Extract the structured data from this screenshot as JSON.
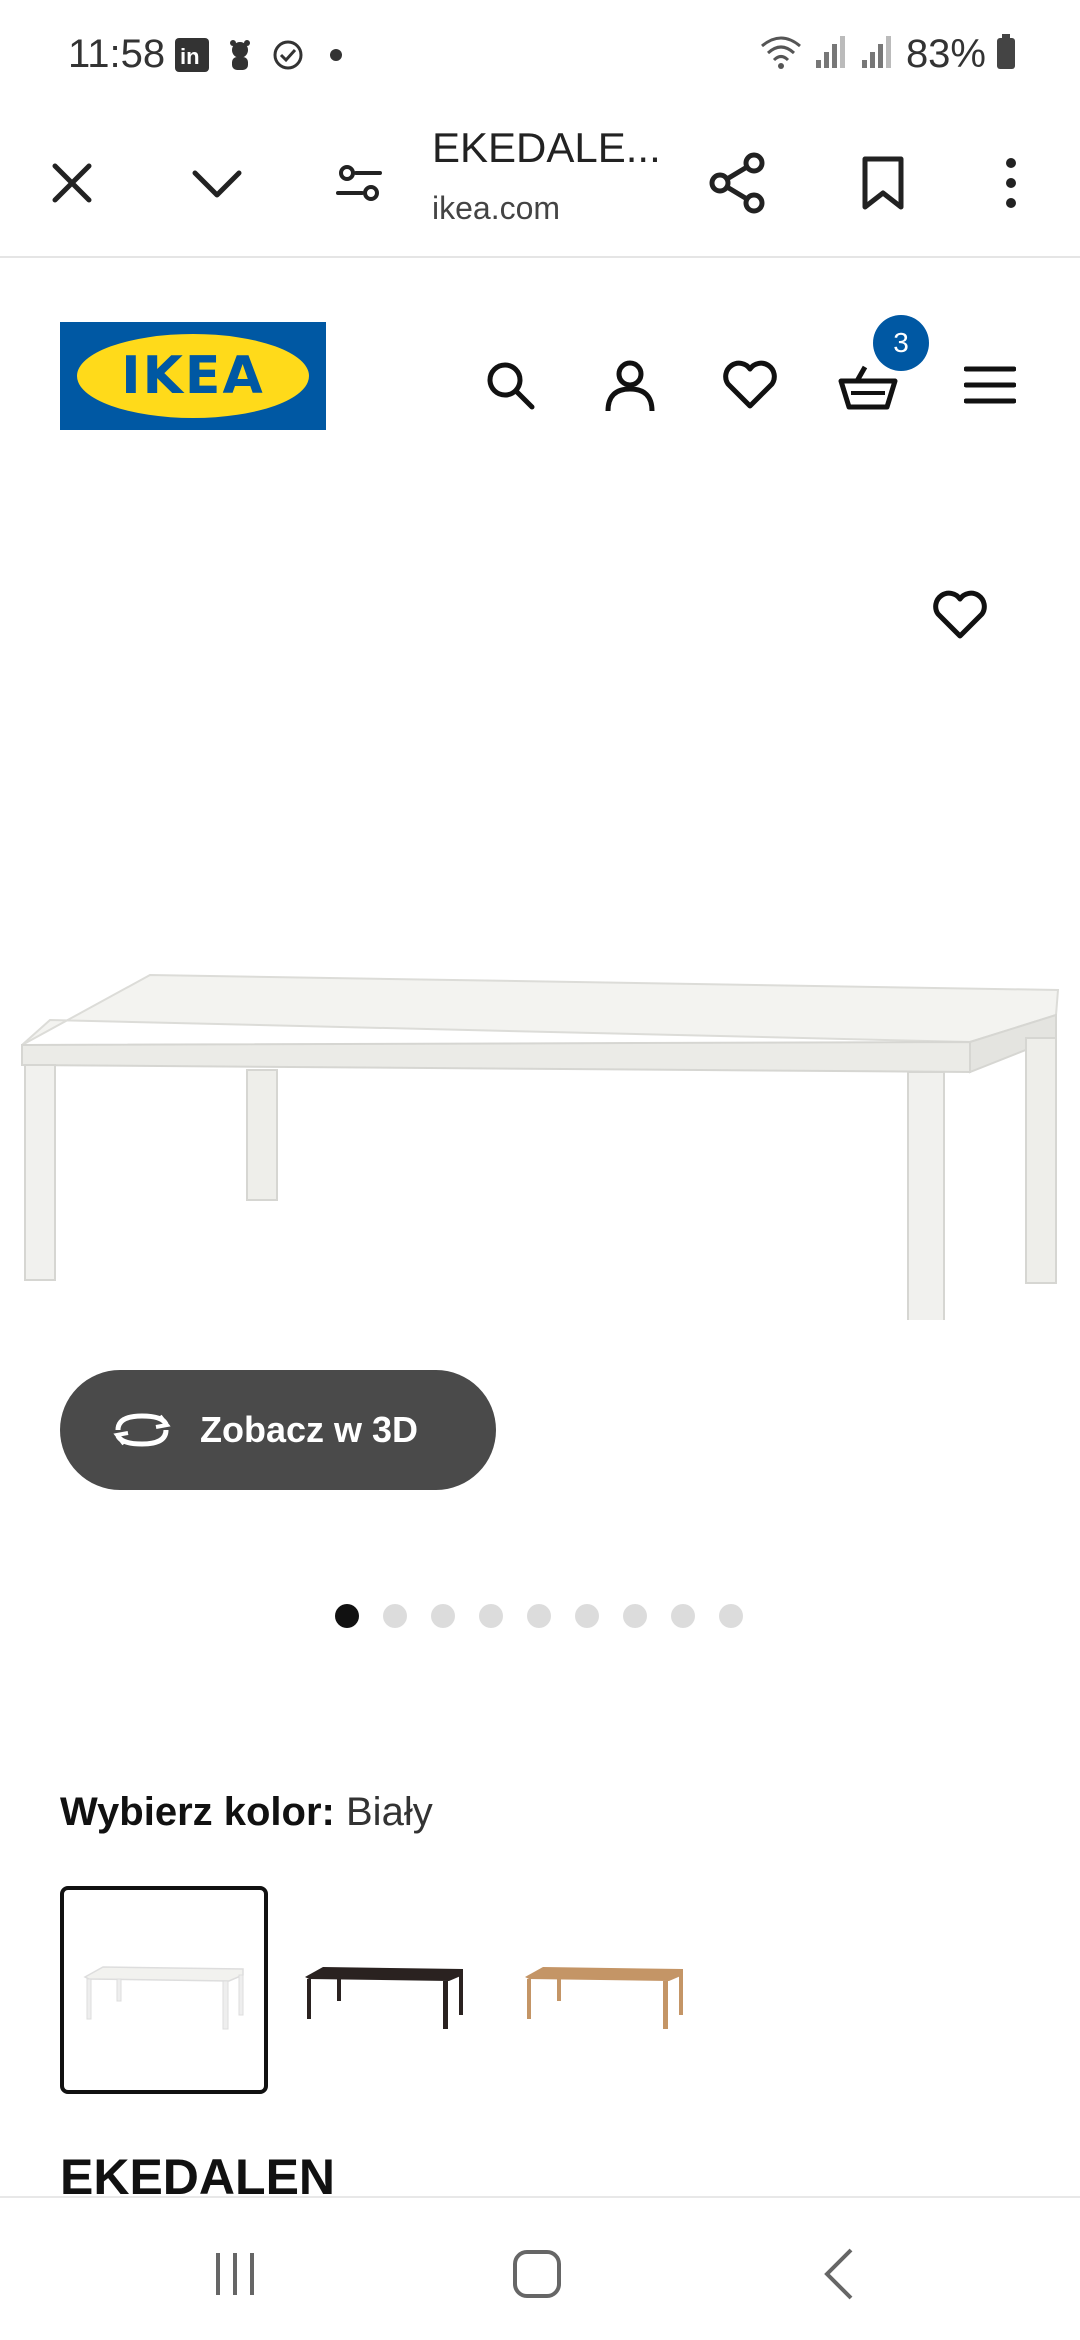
{
  "status_bar": {
    "time": "11:58",
    "battery": "83%",
    "icons_left": [
      "linkedin-icon",
      "bear-icon",
      "check-circle-icon",
      "dot-icon"
    ],
    "icons_right": [
      "wifi-icon",
      "signal-icon",
      "signal-icon",
      "battery-icon"
    ]
  },
  "browser": {
    "title": "EKEDALE...",
    "url": "ikea.com",
    "buttons": [
      "close",
      "collapse",
      "page-settings",
      "share",
      "bookmark",
      "more"
    ]
  },
  "site_header": {
    "logo_text": "IKEA",
    "cart_count": "3",
    "icons": [
      "search-icon",
      "user-icon",
      "heart-icon",
      "basket-icon",
      "menu-icon"
    ]
  },
  "product_gallery": {
    "view3d_label": "Zobacz w 3D",
    "dots_total": 9,
    "active_dot": 1
  },
  "color_selector": {
    "label": "Wybierz kolor:",
    "value": "Biały",
    "options": [
      {
        "name": "white",
        "color": "#f2f2ef",
        "selected": true
      },
      {
        "name": "dark-brown",
        "color": "#2a2220",
        "selected": false
      },
      {
        "name": "oak",
        "color": "#c49566",
        "selected": false
      }
    ]
  },
  "product": {
    "name": "EKEDALEN"
  },
  "colors": {
    "ikea_blue": "#0058a3",
    "ikea_yellow": "#ffda1a",
    "button_dark": "#4a4a4a"
  }
}
